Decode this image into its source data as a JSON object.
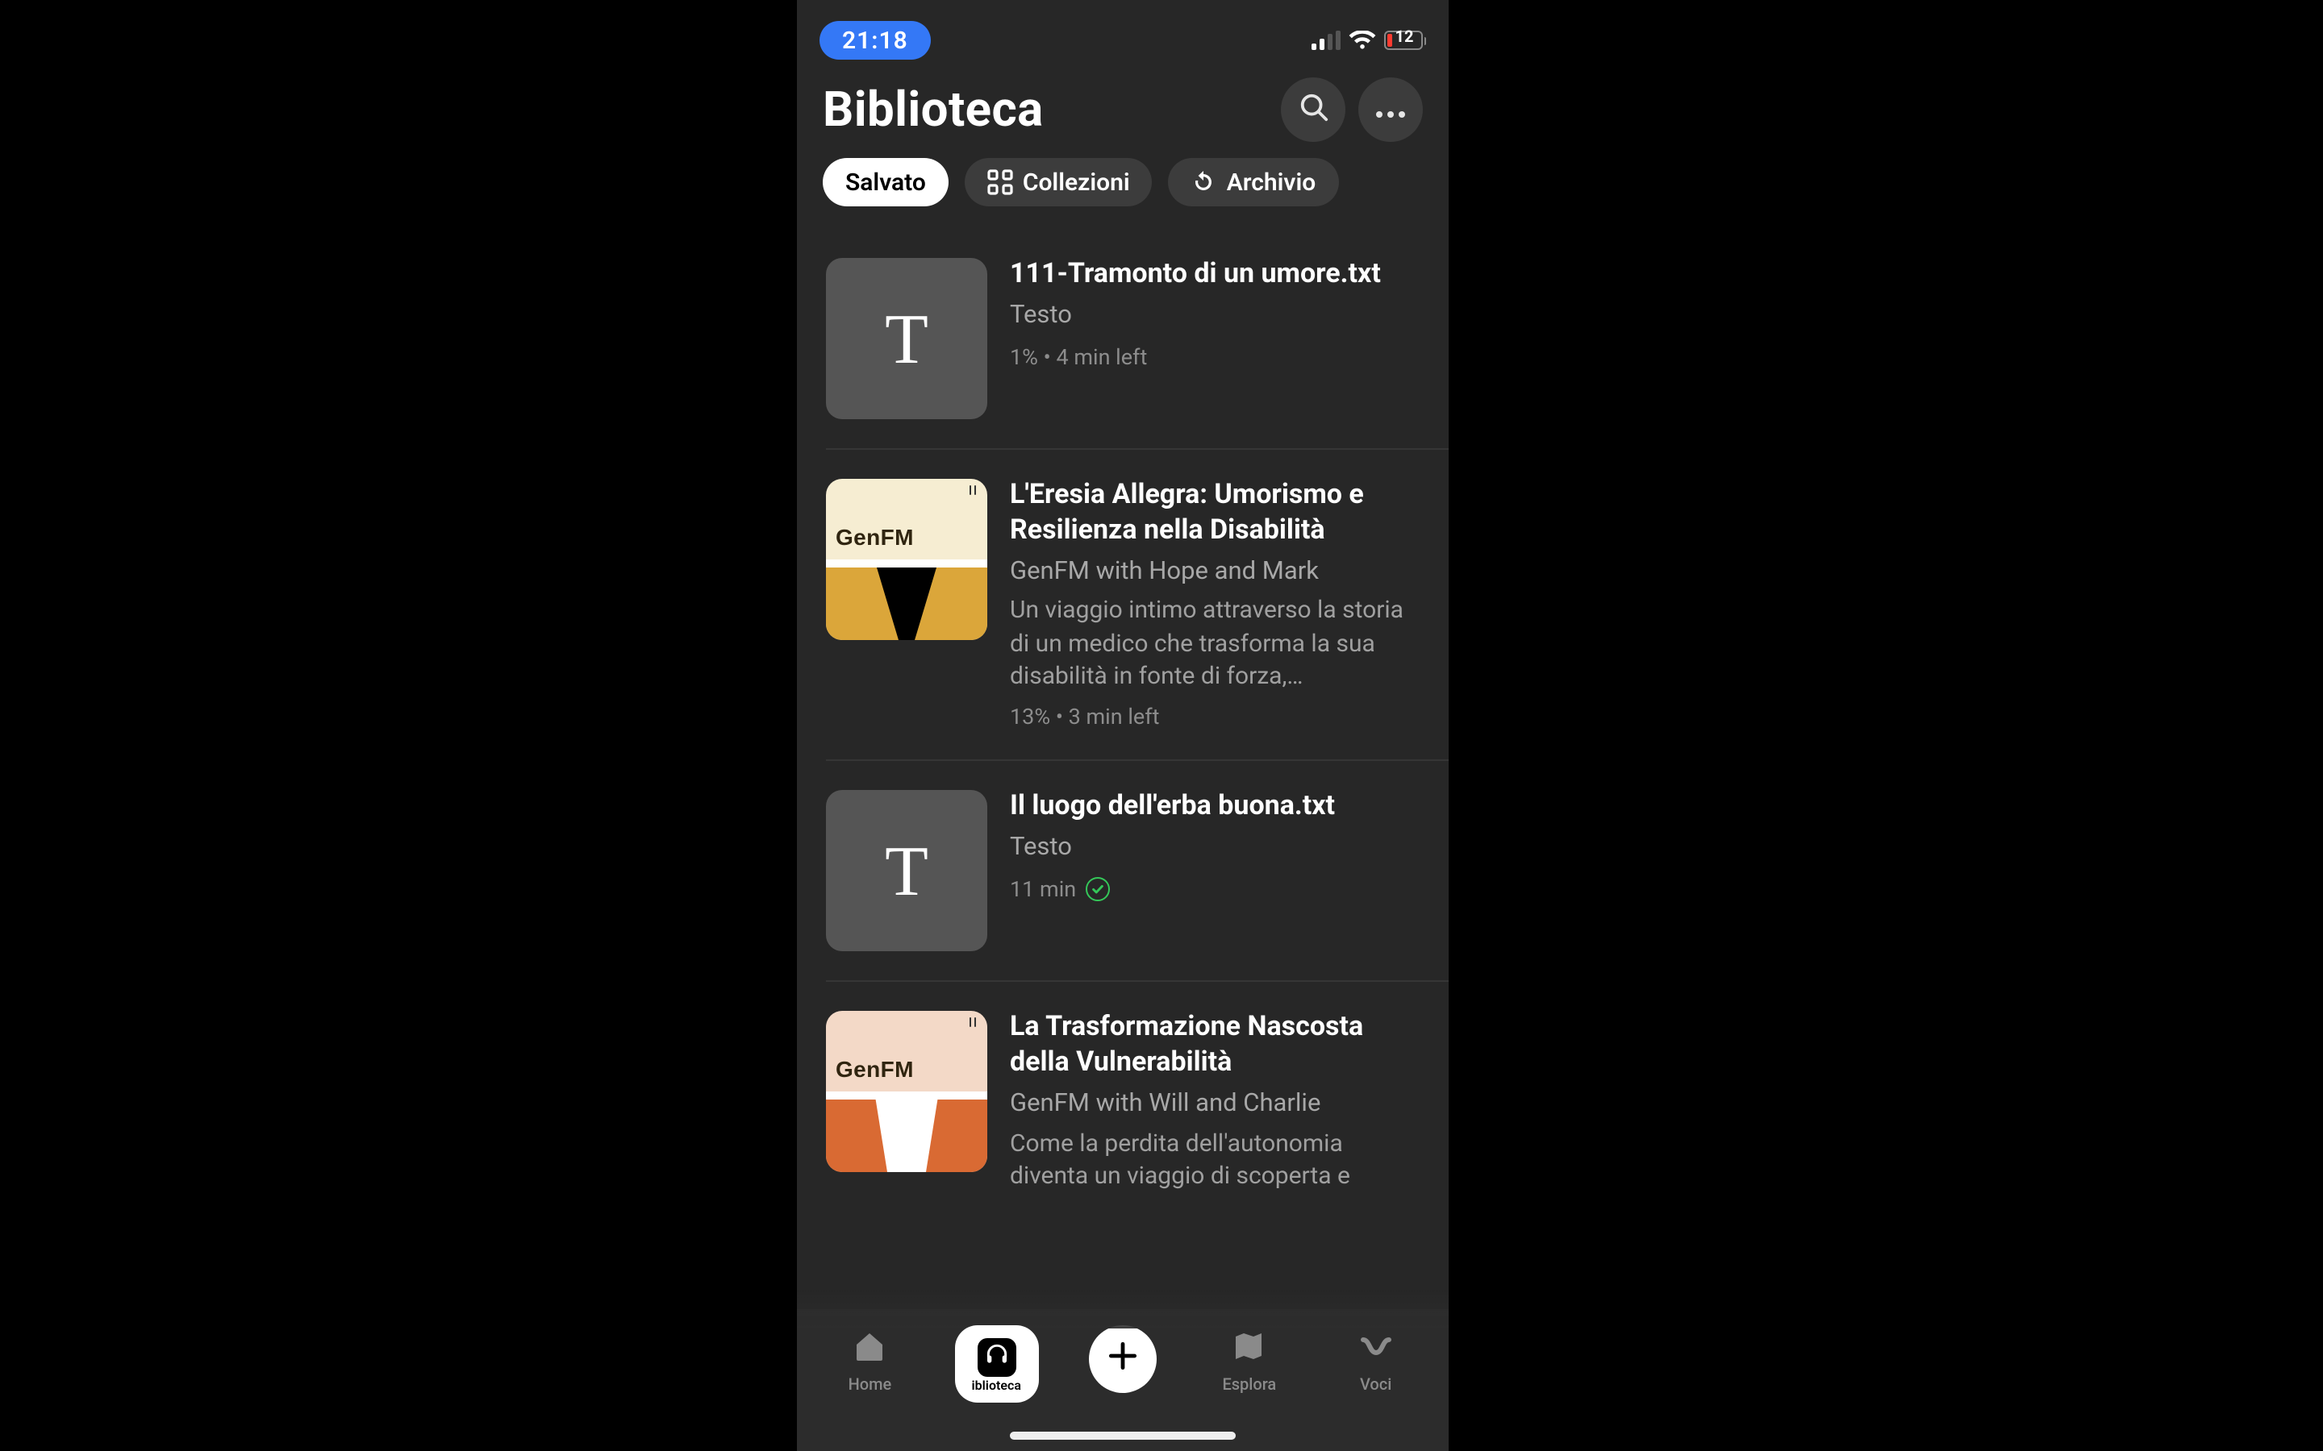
{
  "status": {
    "time": "21:18",
    "battery": "12"
  },
  "header": {
    "title": "Biblioteca"
  },
  "chips": {
    "saved": "Salvato",
    "collections": "Collezioni",
    "archive": "Archivio"
  },
  "items": [
    {
      "title": "111-Tramonto di un umore.txt",
      "subtitle": "Testo",
      "status": "1% • 4 min left",
      "thumb_kind": "text"
    },
    {
      "title": "L'Eresia Allegra: Umorismo e Resilienza nella Disabilità",
      "subtitle": "GenFM with Hope and Mark",
      "description": "Un viaggio intimo attraverso la storia di un medico che trasforma la sua disabilità in fonte di forza,…",
      "status": "13% • 3 min left",
      "thumb_kind": "genfm",
      "thumb_label": "GenFM"
    },
    {
      "title": "Il luogo dell'erba buona.txt",
      "subtitle": "Testo",
      "status": "11 min",
      "thumb_kind": "text",
      "completed": true
    },
    {
      "title": "La Trasformazione Nascosta della Vulnerabilità",
      "subtitle": "GenFM with Will and Charlie",
      "description": "Come la perdita dell'autonomia diventa un viaggio di scoperta e",
      "status": "",
      "thumb_kind": "genfm-peach",
      "thumb_label": "GenFM"
    }
  ],
  "tabs": {
    "home": "Home",
    "library": "iblioteca",
    "explore": "Esplora",
    "voices": "Voci"
  }
}
